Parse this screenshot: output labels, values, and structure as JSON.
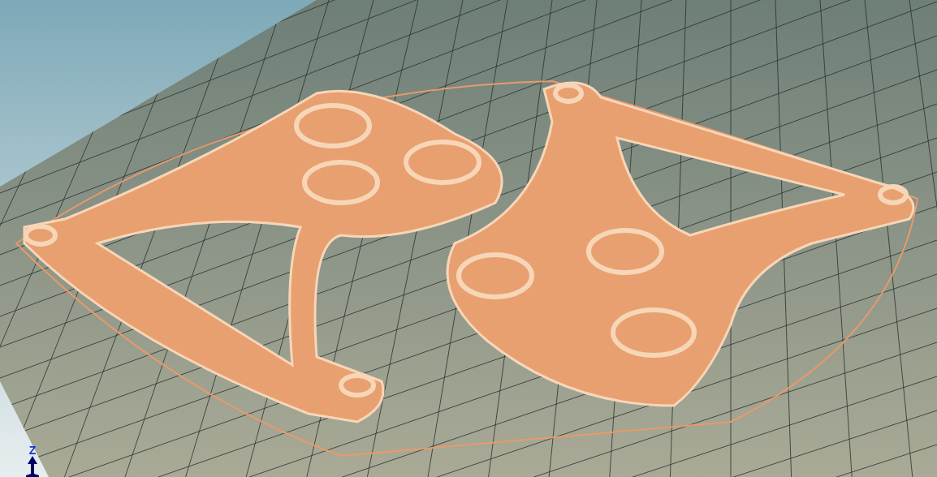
{
  "viewport": {
    "axis_gizmo": {
      "label": "Z"
    }
  }
}
